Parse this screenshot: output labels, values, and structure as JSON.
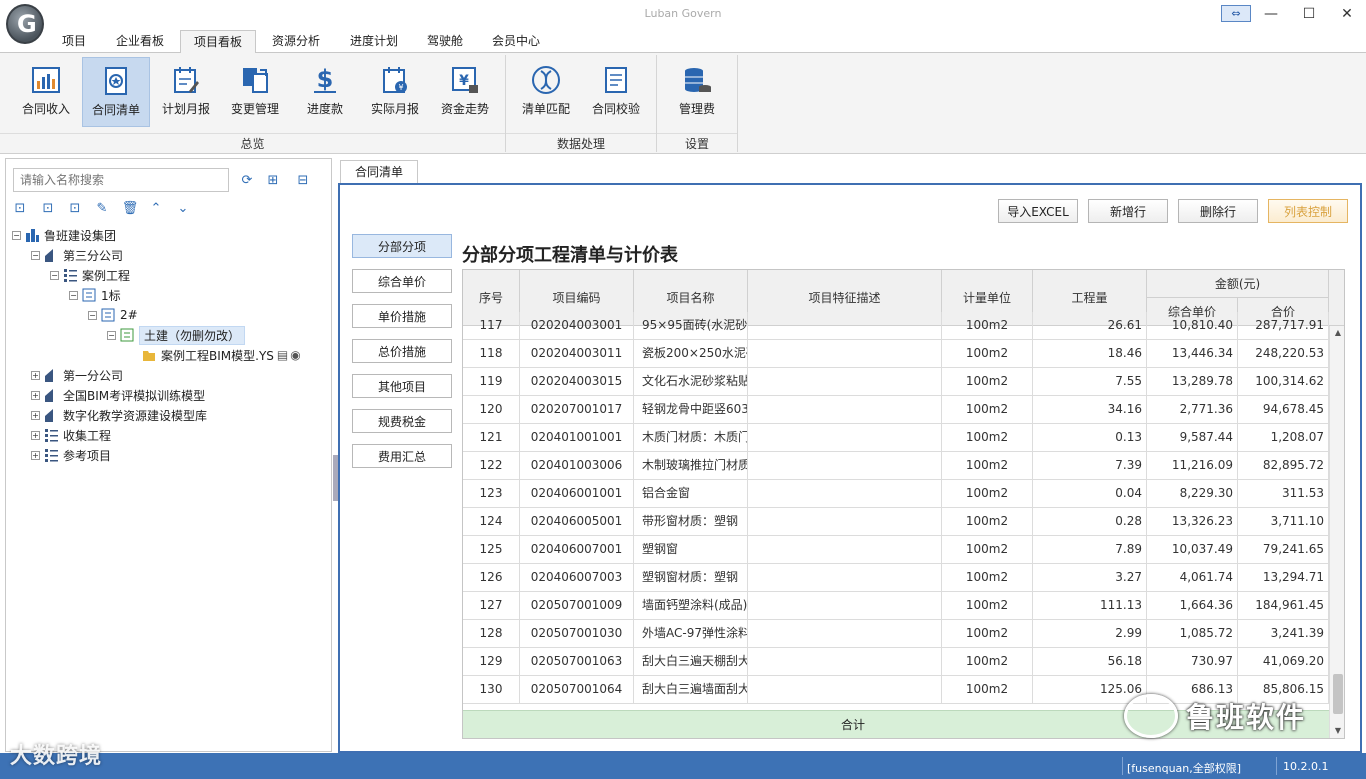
{
  "app": {
    "title": "Luban Govern",
    "logo_letter": "G"
  },
  "window_buttons": {
    "swap": "⇔",
    "minimize": "—",
    "maximize": "☐",
    "close": "✕"
  },
  "menu_tabs": [
    "项目",
    "企业看板",
    "项目看板",
    "资源分析",
    "进度计划",
    "驾驶舱",
    "会员中心"
  ],
  "active_menu_tab": "项目看板",
  "ribbon": {
    "groups": [
      {
        "label": "总览",
        "buttons": [
          {
            "label": "合同收入",
            "icon": "chart-icon"
          },
          {
            "label": "合同清单",
            "icon": "contract-list-icon",
            "active": true
          },
          {
            "label": "计划月报",
            "icon": "plan-report-icon"
          },
          {
            "label": "变更管理",
            "icon": "change-icon"
          },
          {
            "label": "进度款",
            "icon": "dollar-icon"
          },
          {
            "label": "实际月报",
            "icon": "actual-report-icon"
          },
          {
            "label": "资金走势",
            "icon": "fund-trend-icon"
          }
        ]
      },
      {
        "label": "数据处理",
        "buttons": [
          {
            "label": "清单匹配",
            "icon": "dna-icon"
          },
          {
            "label": "合同校验",
            "icon": "verify-icon"
          }
        ]
      },
      {
        "label": "设置",
        "buttons": [
          {
            "label": "管理费",
            "icon": "coins-icon"
          }
        ]
      }
    ]
  },
  "left_panel": {
    "search_placeholder": "请输入名称搜索",
    "tree": [
      {
        "label": "鲁班建设集团",
        "level": 0,
        "expander": "−",
        "icon": "building"
      },
      {
        "label": "第三分公司",
        "level": 1,
        "expander": "−",
        "icon": "house"
      },
      {
        "label": "案例工程",
        "level": 2,
        "expander": "−",
        "icon": "list"
      },
      {
        "label": "1标",
        "level": 3,
        "expander": "−",
        "icon": "doc-blue"
      },
      {
        "label": "2#",
        "level": 4,
        "expander": "−",
        "icon": "doc-blue"
      },
      {
        "label": "土建（勿删勿改）",
        "level": 5,
        "expander": "−",
        "icon": "doc-green",
        "selected": true
      },
      {
        "label": "案例工程BIM模型.YS",
        "level": 6,
        "expander": "",
        "icon": "folder"
      },
      {
        "label": "第一分公司",
        "level": 1,
        "expander": "+",
        "icon": "house"
      },
      {
        "label": "全国BIM考评模拟训练模型",
        "level": 1,
        "expander": "+",
        "icon": "house"
      },
      {
        "label": "数字化教学资源建设模型库",
        "level": 1,
        "expander": "+",
        "icon": "house"
      },
      {
        "label": "收集工程",
        "level": 1,
        "expander": "+",
        "icon": "list"
      },
      {
        "label": "参考项目",
        "level": 1,
        "expander": "+",
        "icon": "list"
      }
    ]
  },
  "doc_tab": "合同清单",
  "top_buttons": [
    "导入EXCEL",
    "新增行",
    "删除行",
    "列表控制"
  ],
  "side_buttons": [
    "分部分项",
    "综合单价",
    "单价措施",
    "总价措施",
    "其他项目",
    "规费税金",
    "费用汇总"
  ],
  "active_side_button": "分部分项",
  "table_title": "分部分项工程清单与计价表",
  "table": {
    "headers": [
      "序号",
      "项目编码",
      "项目名称",
      "项目特征描述",
      "计量单位",
      "工程量",
      "金额(元)",
      "综合单价",
      "合价"
    ],
    "rows": [
      [
        "117",
        "020204003001",
        "95×95面砖(水泥砂浆",
        "",
        "100m2",
        "26.61",
        "10,810.40",
        "287,717.91"
      ],
      [
        "118",
        "020204003011",
        "瓷板200×250水泥砂",
        "",
        "100m2",
        "18.46",
        "13,446.34",
        "248,220.53"
      ],
      [
        "119",
        "020204003015",
        "文化石水泥砂浆粘贴",
        "",
        "100m2",
        "7.55",
        "13,289.78",
        "100,314.62"
      ],
      [
        "120",
        "020207001017",
        "轻钢龙骨中距竖603",
        "",
        "100m2",
        "34.16",
        "2,771.36",
        "94,678.45"
      ],
      [
        "121",
        "020401001001",
        "木质门材质：木质门",
        "",
        "100m2",
        "0.13",
        "9,587.44",
        "1,208.07"
      ],
      [
        "122",
        "020401003006",
        "木制玻璃推拉门材质",
        "",
        "100m2",
        "7.39",
        "11,216.09",
        "82,895.72"
      ],
      [
        "123",
        "020406001001",
        "铝合金窗",
        "",
        "100m2",
        "0.04",
        "8,229.30",
        "311.53"
      ],
      [
        "124",
        "020406005001",
        "带形窗材质：塑钢",
        "",
        "100m2",
        "0.28",
        "13,326.23",
        "3,711.10"
      ],
      [
        "125",
        "020406007001",
        "塑钢窗",
        "",
        "100m2",
        "7.89",
        "10,037.49",
        "79,241.65"
      ],
      [
        "126",
        "020406007003",
        "塑钢窗材质：塑钢",
        "",
        "100m2",
        "3.27",
        "4,061.74",
        "13,294.71"
      ],
      [
        "127",
        "020507001009",
        "墙面钙塑涂料(成品)",
        "",
        "100m2",
        "111.13",
        "1,664.36",
        "184,961.45"
      ],
      [
        "128",
        "020507001030",
        "外墙AC-97弹性涂料",
        "",
        "100m2",
        "2.99",
        "1,085.72",
        "3,241.39"
      ],
      [
        "129",
        "020507001063",
        "刮大白三遍天棚刮大",
        "",
        "100m2",
        "56.18",
        "730.97",
        "41,069.20"
      ],
      [
        "130",
        "020507001064",
        "刮大白三遍墙面刮大",
        "",
        "100m2",
        "125.06",
        "686.13",
        "85,806.15"
      ]
    ],
    "total_label": "合计"
  },
  "status": {
    "user": "[fusenquan,全部权限]",
    "version": "10.2.0.1"
  },
  "watermarks": {
    "left": "大数跨境",
    "right": "鲁班软件"
  },
  "colors": {
    "accent": "#3d72b5",
    "selected": "#c7d9ef",
    "total_row": "#d8efd8",
    "orange_btn": "#d9a23f"
  }
}
